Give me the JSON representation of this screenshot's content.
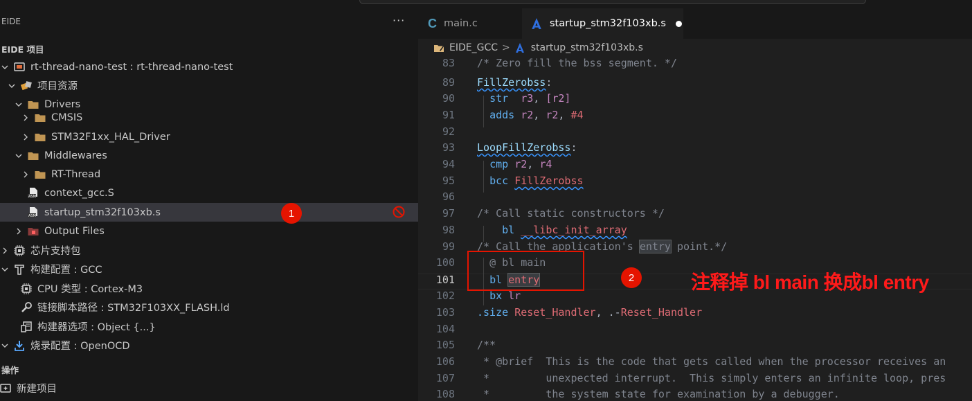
{
  "command_center": "",
  "sidebar": {
    "header": "EIDE",
    "more_label": "···",
    "section_project": "EIDE 项目",
    "section_ops": "操作",
    "tree": [
      {
        "label": "rt-thread-nano-test : rt-thread-nano-test",
        "icon": "project-icon",
        "indent": 0,
        "chev": "down"
      },
      {
        "label": "项目资源",
        "icon": "resources-icon",
        "indent": 1,
        "chev": "down"
      },
      {
        "label": "Drivers",
        "icon": "folder-icon",
        "indent": 2,
        "chev": "down"
      },
      {
        "label": "CMSIS",
        "icon": "folder-icon",
        "indent": 3,
        "chev": "right"
      },
      {
        "label": "STM32F1xx_HAL_Driver",
        "icon": "folder-icon",
        "indent": 3,
        "chev": "right"
      },
      {
        "label": "Middlewares",
        "icon": "folder-icon",
        "indent": 2,
        "chev": "down"
      },
      {
        "label": "RT-Thread",
        "icon": "folder-icon",
        "indent": 3,
        "chev": "right"
      },
      {
        "label": "context_gcc.S",
        "icon": "asm-file-icon",
        "indent": 2,
        "chev": "none"
      },
      {
        "label": "startup_stm32f103xb.s",
        "icon": "asm-file-icon",
        "indent": 2,
        "chev": "none",
        "selected": true
      },
      {
        "label": "Output Files",
        "icon": "output-folder-icon",
        "indent": 2,
        "chev": "right"
      },
      {
        "label": "芯片支持包",
        "icon": "chip-icon",
        "indent": 0,
        "chev": "right"
      },
      {
        "label": "构建配置 : GCC",
        "icon": "build-icon",
        "indent": 0,
        "chev": "down"
      },
      {
        "label": "CPU 类型 : Cortex-M3",
        "icon": "chip-icon",
        "indent": 1,
        "chev": "none"
      },
      {
        "label": "链接脚本路径 : STM32F103XX_FLASH.ld",
        "icon": "wrench-icon",
        "indent": 1,
        "chev": "none"
      },
      {
        "label": "构建器选项 : Object {...}",
        "icon": "options-icon",
        "indent": 1,
        "chev": "none"
      },
      {
        "label": "烧录配置 : OpenOCD",
        "icon": "flash-icon",
        "indent": 0,
        "chev": "down"
      }
    ],
    "ops": [
      {
        "label": "新建项目",
        "icon": "new-project-icon"
      }
    ]
  },
  "tabs": [
    {
      "label": "main.c",
      "icon": "c-file-icon",
      "active": false
    },
    {
      "label": "startup_stm32f103xb.s",
      "icon": "asm-tab-icon",
      "active": true,
      "dirty": true
    }
  ],
  "breadcrumb": {
    "folder": "EIDE_GCC",
    "separator": ">",
    "file": "startup_stm32f103xb.s"
  },
  "code": {
    "current_line": "101",
    "lines": [
      {
        "n": "83",
        "tokens": [
          [
            "/* Zero fill the bss segment. */",
            "com"
          ]
        ]
      },
      {
        "n": "89",
        "tokens": [
          [
            "FillZerobss",
            "lab",
            "squig"
          ],
          [
            ":",
            "plain"
          ]
        ]
      },
      {
        "n": "90",
        "tokens": [
          [
            "  ",
            "plain"
          ],
          [
            "str",
            "ins2"
          ],
          [
            "  ",
            "plain"
          ],
          [
            "r3",
            "reg"
          ],
          [
            ", ",
            "plain"
          ],
          [
            "[r2]",
            "reg"
          ]
        ]
      },
      {
        "n": "91",
        "tokens": [
          [
            "  ",
            "plain"
          ],
          [
            "adds",
            "ins2"
          ],
          [
            " ",
            "plain"
          ],
          [
            "r2",
            "reg"
          ],
          [
            ", ",
            "plain"
          ],
          [
            "r2",
            "reg"
          ],
          [
            ", ",
            "plain"
          ],
          [
            "#4",
            "num"
          ]
        ]
      },
      {
        "n": "92",
        "tokens": []
      },
      {
        "n": "93",
        "tokens": [
          [
            "LoopFillZerobss",
            "lab",
            "squig"
          ],
          [
            ":",
            "plain"
          ]
        ]
      },
      {
        "n": "94",
        "tokens": [
          [
            "  ",
            "plain"
          ],
          [
            "cmp",
            "ins2"
          ],
          [
            " ",
            "plain"
          ],
          [
            "r2",
            "reg"
          ],
          [
            ", ",
            "plain"
          ],
          [
            "r4",
            "reg"
          ]
        ]
      },
      {
        "n": "95",
        "tokens": [
          [
            "  ",
            "plain"
          ],
          [
            "bcc",
            "ins2"
          ],
          [
            " ",
            "plain"
          ],
          [
            "FillZerobss",
            "sym",
            "squig"
          ]
        ]
      },
      {
        "n": "96",
        "tokens": []
      },
      {
        "n": "97",
        "tokens": [
          [
            "/* Call static constructors */",
            "com"
          ]
        ]
      },
      {
        "n": "98",
        "tokens": [
          [
            "    ",
            "plain"
          ],
          [
            "bl",
            "ins2"
          ],
          [
            " ",
            "plain"
          ],
          [
            "__libc_init_array",
            "sym",
            "squig"
          ]
        ]
      },
      {
        "n": "99",
        "tokens": [
          [
            "/* Call the application's ",
            "com"
          ],
          [
            "entry",
            "com",
            "hl"
          ],
          [
            " point.*/",
            "com"
          ]
        ]
      },
      {
        "n": "100",
        "tokens": [
          [
            "  ",
            "plain"
          ],
          [
            "@ bl main",
            "com"
          ]
        ]
      },
      {
        "n": "101",
        "tokens": [
          [
            "  ",
            "plain"
          ],
          [
            "bl",
            "ins2"
          ],
          [
            " ",
            "plain"
          ],
          [
            "entry",
            "sym",
            "hl"
          ]
        ]
      },
      {
        "n": "102",
        "tokens": [
          [
            "  ",
            "plain"
          ],
          [
            "bx",
            "ins2"
          ],
          [
            " ",
            "plain"
          ],
          [
            "lr",
            "reg"
          ]
        ]
      },
      {
        "n": "103",
        "tokens": [
          [
            ".size",
            "ins2"
          ],
          [
            " ",
            "plain"
          ],
          [
            "Reset_Handler",
            "sym"
          ],
          [
            ", .-",
            "plain"
          ],
          [
            "Reset_Handler",
            "sym"
          ]
        ]
      },
      {
        "n": "104",
        "tokens": []
      },
      {
        "n": "105",
        "tokens": [
          [
            "/**",
            "com"
          ]
        ]
      },
      {
        "n": "106",
        "tokens": [
          [
            " * @brief  This is the code that gets called when the processor receives an",
            "com"
          ]
        ]
      },
      {
        "n": "107",
        "tokens": [
          [
            " *         unexpected interrupt.  This simply enters an infinite loop, pres",
            "com"
          ]
        ]
      },
      {
        "n": "108",
        "tokens": [
          [
            " *         the system state for examination by a debugger.",
            "com"
          ]
        ]
      }
    ]
  },
  "annotations": {
    "badge1": "1",
    "badge2": "2",
    "note": "注释掉 bl main 换成bl entry",
    "accent": "#e51400"
  }
}
